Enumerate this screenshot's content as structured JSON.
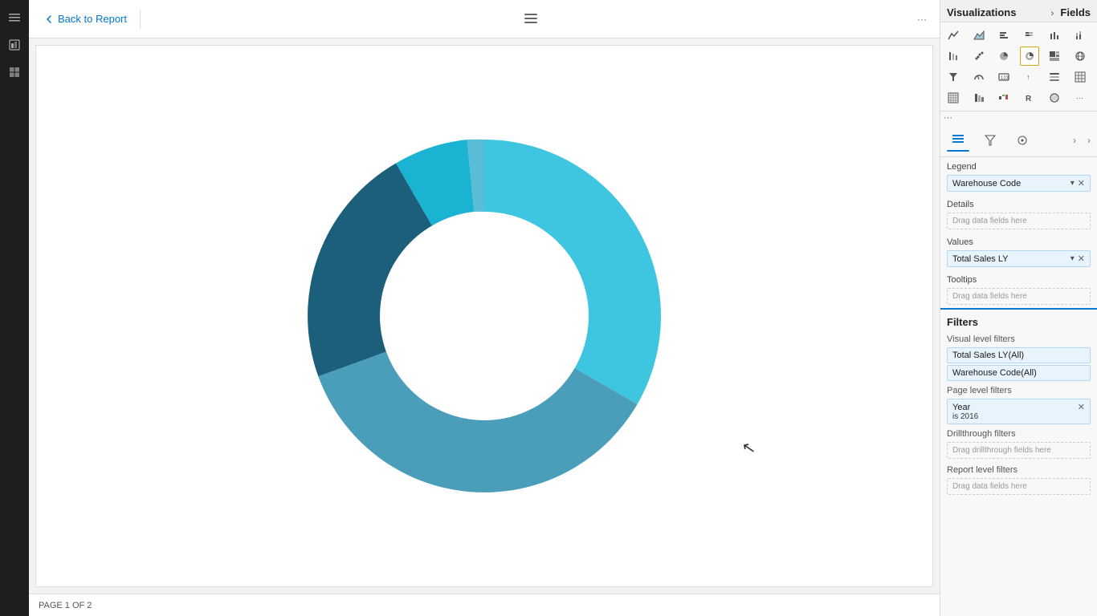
{
  "leftSidebar": {
    "icons": [
      "≡",
      "📊",
      "🔲"
    ]
  },
  "topBar": {
    "backLabel": "Back to Report",
    "menuIcon": "≡",
    "moreIcon": "···"
  },
  "canvas": {
    "donut": {
      "segments": [
        {
          "color": "#3ec6e0",
          "startAngle": -90,
          "endAngle": 30,
          "label": "Light Blue large"
        },
        {
          "color": "#2a9dbf",
          "startAngle": 30,
          "endAngle": 160,
          "label": "Medium Blue"
        },
        {
          "color": "#1c5f7a",
          "startAngle": 160,
          "endAngle": 220,
          "label": "Dark Blue"
        },
        {
          "color": "#1ab3d1",
          "startAngle": 220,
          "endAngle": 255,
          "label": "Bright Blue small"
        },
        {
          "color": "#5abdd6",
          "startAngle": 255,
          "endAngle": 270,
          "label": "Light Blue tiny"
        },
        {
          "color": "#4a9eba",
          "startAngle": 270,
          "endAngle": 360,
          "label": "Steel Blue"
        }
      ]
    }
  },
  "bottomBar": {
    "pageInfo": "PAGE 1 OF 2"
  },
  "rightPanel": {
    "header": {
      "title": "Visualizations",
      "fieldsLabel": "Fields"
    },
    "vizIcons": [
      {
        "id": "line",
        "symbol": "📈"
      },
      {
        "id": "bar-stacked",
        "symbol": "▦"
      },
      {
        "id": "bar-clustered",
        "symbol": "▥"
      },
      {
        "id": "bar-100",
        "symbol": "▤"
      },
      {
        "id": "col-clustered",
        "symbol": "▧"
      },
      {
        "id": "col-stacked",
        "symbol": "▨"
      },
      {
        "id": "col-100",
        "symbol": "▩"
      },
      {
        "id": "area",
        "symbol": "▲"
      },
      {
        "id": "scatter",
        "symbol": "⊡"
      },
      {
        "id": "pie",
        "symbol": "◕"
      },
      {
        "id": "donut",
        "symbol": "◎",
        "active": true
      },
      {
        "id": "treemap",
        "symbol": "▦"
      },
      {
        "id": "map",
        "symbol": "🗺"
      },
      {
        "id": "funnel",
        "symbol": "⊲"
      },
      {
        "id": "gauge",
        "symbol": "◑"
      },
      {
        "id": "card",
        "symbol": "▭"
      },
      {
        "id": "kpi",
        "symbol": "↑"
      },
      {
        "id": "slicer",
        "symbol": "☰"
      },
      {
        "id": "table",
        "symbol": "▦"
      },
      {
        "id": "matrix",
        "symbol": "⊞"
      },
      {
        "id": "ribbon",
        "symbol": "🎗"
      },
      {
        "id": "waterfall",
        "symbol": "≋"
      },
      {
        "id": "r-visual",
        "symbol": "R"
      },
      {
        "id": "globe",
        "symbol": "🌐"
      }
    ],
    "tabs": [
      {
        "id": "fields",
        "icon": "☰",
        "active": true
      },
      {
        "id": "filter",
        "icon": "▽"
      },
      {
        "id": "analytics",
        "icon": "⊙"
      }
    ],
    "fieldSections": {
      "legend": {
        "label": "Legend",
        "chip": "Warehouse Code",
        "dragArea": ""
      },
      "details": {
        "label": "Details",
        "dragText": "Drag data fields here"
      },
      "values": {
        "label": "Values",
        "chip": "Total Sales LY",
        "dragArea": ""
      },
      "tooltips": {
        "label": "Tooltips",
        "dragText": "Drag data fields here"
      }
    },
    "filters": {
      "sectionTitle": "Filters",
      "visualLevelLabel": "Visual level filters",
      "chips": [
        {
          "label": "Total Sales LY(All)"
        },
        {
          "label": "Warehouse Code(All)"
        }
      ],
      "pageLevelLabel": "Page level filters",
      "pageChips": [
        {
          "label": "Year",
          "value": "is 2016",
          "hasX": true
        }
      ],
      "drillthroughLabel": "Drillthrough filters",
      "drillthroughDrag": "Drag drillthrough fields here",
      "reportLevelLabel": "Report level filters",
      "reportLevelDrag": "Drag data fields here"
    }
  }
}
